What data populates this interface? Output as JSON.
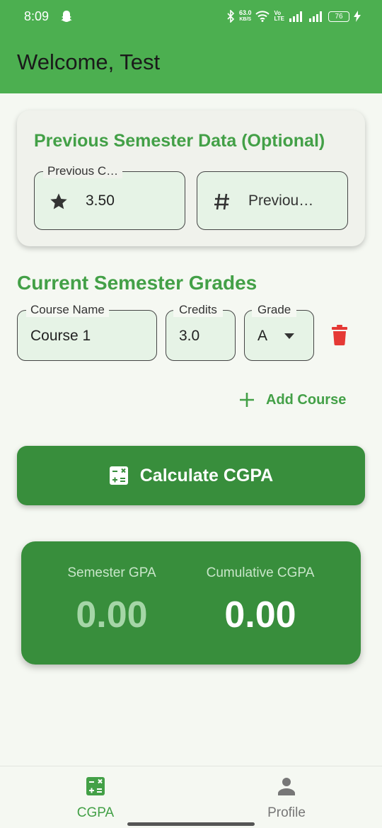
{
  "status_bar": {
    "time": "8:09",
    "speed_value": "63.0",
    "speed_unit": "KB/S",
    "volte": "Vo\nLTE",
    "battery": "76"
  },
  "app_bar": {
    "title": "Welcome, Test"
  },
  "previous_semester": {
    "title": "Previous Semester Data (Optional)",
    "cgpa_field": {
      "label": "Previous C…",
      "value": "3.50",
      "icon": "star-icon"
    },
    "credits_field": {
      "placeholder": "Previou…",
      "icon": "hash-icon"
    }
  },
  "current_semester": {
    "title": "Current Semester Grades",
    "courses": [
      {
        "name_label": "Course Name",
        "name": "Course 1",
        "credits_label": "Credits",
        "credits": "3.0",
        "grade_label": "Grade",
        "grade": "A"
      }
    ],
    "add_course_label": "Add Course"
  },
  "calculate_button": {
    "label": "Calculate CGPA",
    "icon": "calculator-icon"
  },
  "results": {
    "semester_label": "Semester GPA",
    "semester_value": "0.00",
    "cumulative_label": "Cumulative CGPA",
    "cumulative_value": "0.00"
  },
  "bottom_nav": {
    "items": [
      {
        "label": "CGPA",
        "icon": "calculator-icon",
        "active": true
      },
      {
        "label": "Profile",
        "icon": "person-icon",
        "active": false
      }
    ]
  },
  "colors": {
    "primary": "#4caf50",
    "primary_dark": "#388e3c",
    "accent_text": "#43a047",
    "field_fill": "#e6f3e6",
    "delete": "#e53935",
    "muted_result": "#a5d6a7"
  }
}
